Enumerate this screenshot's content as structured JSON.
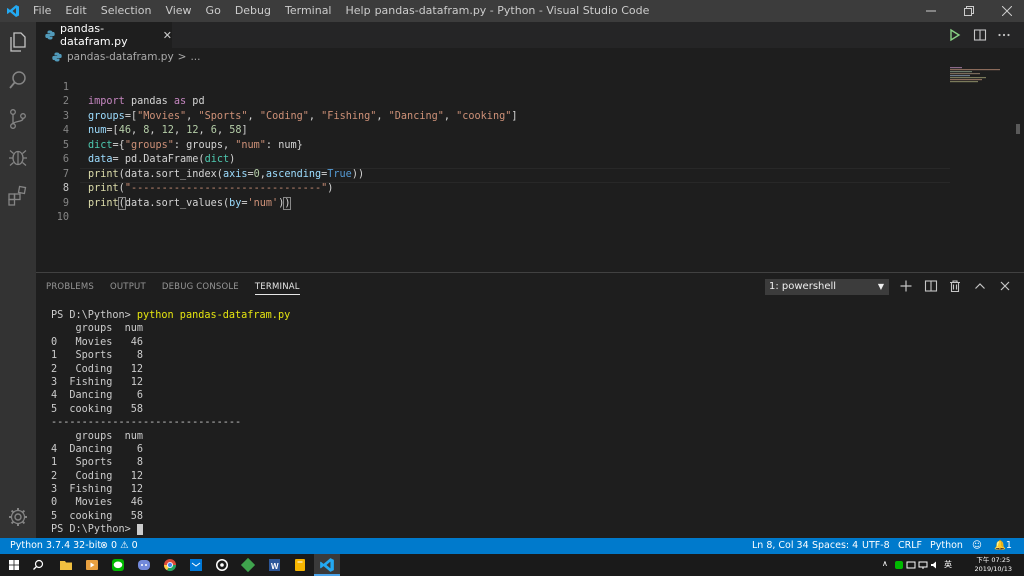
{
  "window": {
    "title": "pandas-datafram.py - Python - Visual Studio Code",
    "menu": [
      "File",
      "Edit",
      "Selection",
      "View",
      "Go",
      "Debug",
      "Terminal",
      "Help"
    ]
  },
  "tab": {
    "filename": "pandas-datafram.py"
  },
  "breadcrumb": {
    "file": "pandas-datafram.py",
    "sep": ">",
    "rest": "..."
  },
  "editor": {
    "current_line": 8,
    "lines": [
      {
        "num": "1",
        "code": "import pandas as pd"
      },
      {
        "num": "2",
        "code": "groups=[\"Movies\", \"Sports\", \"Coding\", \"Fishing\", \"Dancing\", \"cooking\"]"
      },
      {
        "num": "3",
        "code": "num=[46, 8, 12, 12, 6, 58]"
      },
      {
        "num": "4",
        "code": "dict={\"groups\": groups, \"num\": num}"
      },
      {
        "num": "5",
        "code": "data= pd.DataFrame(dict)"
      },
      {
        "num": "6",
        "code": "print(data.sort_index(axis=0,ascending=True))"
      },
      {
        "num": "7",
        "code": "print(\"-------------------------------\")"
      },
      {
        "num": "8",
        "code": "print(data.sort_values(by='num'))"
      },
      {
        "num": "9",
        "code": ""
      },
      {
        "num": "10",
        "code": ""
      }
    ]
  },
  "panel": {
    "tabs": [
      "PROBLEMS",
      "OUTPUT",
      "DEBUG CONSOLE",
      "TERMINAL"
    ],
    "active_tab": "TERMINAL",
    "terminal_select": "1: powershell",
    "prompt": "PS D:\\Python>",
    "command": "python pandas-datafram.py",
    "output_lines": [
      "    groups  num",
      "0   Movies   46",
      "1   Sports    8",
      "2   Coding   12",
      "3  Fishing   12",
      "4  Dancing    6",
      "5  cooking   58",
      "-------------------------------",
      "    groups  num",
      "4  Dancing    6",
      "1   Sports    8",
      "2   Coding   12",
      "3  Fishing   12",
      "0   Movies   46",
      "5  cooking   58"
    ]
  },
  "statusbar": {
    "python": "Python 3.7.4 32-bit",
    "errors": "0",
    "warnings": "0",
    "position": "Ln 8, Col 34",
    "spaces": "Spaces: 4",
    "encoding": "UTF-8",
    "eol": "CRLF",
    "language": "Python",
    "notifications": "1"
  },
  "taskbar": {
    "ime": "英",
    "time": "下午 07:25",
    "date": "2019/10/13"
  },
  "colors": {
    "accent": "#007acc",
    "keyword": "#c586c0",
    "string": "#ce9178",
    "function": "#dcdcaa",
    "param": "#9cdcfe",
    "constant": "#569cd6",
    "terminal_command": "#e5e510"
  }
}
